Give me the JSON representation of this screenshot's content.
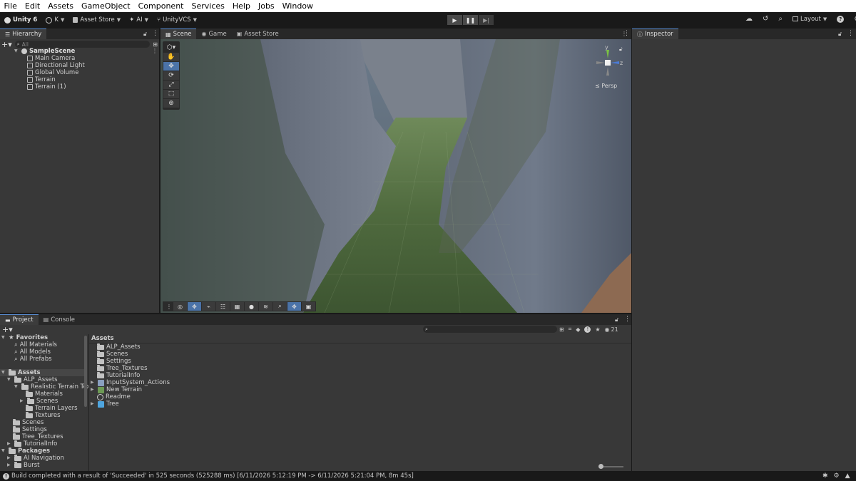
{
  "menu": [
    "File",
    "Edit",
    "Assets",
    "GameObject",
    "Component",
    "Services",
    "Help",
    "Jobs",
    "Window"
  ],
  "toolbar": {
    "unity_label": "Unity 6",
    "account": "K",
    "asset_store": "Asset Store",
    "ai": "AI",
    "vcs": "UnityVCS",
    "layout": "Layout"
  },
  "hierarchy": {
    "tab": "Hierarchy",
    "search_placeholder": "All",
    "scene": "SampleScene",
    "items": [
      "Main Camera",
      "Directional Light",
      "Global Volume",
      "Terrain",
      "Terrain (1)"
    ]
  },
  "scene_tabs": [
    "Scene",
    "Game",
    "Asset Store"
  ],
  "gizmo": {
    "y": "y",
    "z": "z",
    "persp": "≤ Persp"
  },
  "inspector": {
    "tab": "Inspector"
  },
  "project": {
    "tabs": [
      "Project",
      "Console"
    ],
    "visible_count": "21",
    "favorites": {
      "label": "Favorites",
      "items": [
        "All Materials",
        "All Models",
        "All Prefabs"
      ]
    },
    "assets_tree": {
      "label": "Assets",
      "alp": "ALP_Assets",
      "rtt": "Realistic Terrain Textu",
      "rtt_children": [
        "Materials",
        "Scenes",
        "Terrain Layers",
        "Textures"
      ],
      "siblings": [
        "Scenes",
        "Settings",
        "Tree_Textures",
        "TutorialInfo"
      ]
    },
    "packages": {
      "label": "Packages",
      "items": [
        "AI Navigation",
        "Burst"
      ]
    },
    "breadcrumb": "Assets",
    "files": [
      "ALP_Assets",
      "Scenes",
      "Settings",
      "Tree_Textures",
      "TutorialInfo",
      "InputSystem_Actions",
      "New Terrain",
      "Readme",
      "Tree"
    ]
  },
  "status": {
    "message": "Build completed with a result of 'Succeeded' in 525 seconds (525288 ms) [6/11/2026 5:12:19 PM -> 6/11/2026 5:21:04 PM, 8m 45s]"
  },
  "colors": {
    "accent": "#4b73a8",
    "panel": "#383838",
    "dark": "#191919"
  }
}
